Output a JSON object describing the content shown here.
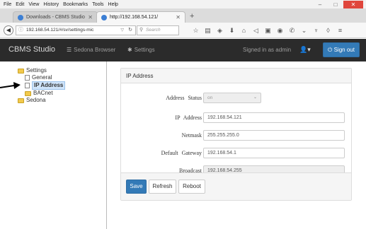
{
  "browser": {
    "menu": [
      "File",
      "Edit",
      "View",
      "History",
      "Bookmarks",
      "Tools",
      "Help"
    ],
    "window_controls": {
      "minimize": "–",
      "maximize": "□",
      "close": "✕"
    },
    "tabs": [
      {
        "label": "Downloads - CBMS Studio",
        "close": "✕"
      },
      {
        "label": "http://192.168.54.121/",
        "close": "✕"
      }
    ],
    "new_tab": "+",
    "url": "192.168.54.121/#/sv/settings-mic",
    "search_placeholder": "Search"
  },
  "app": {
    "brand": "CBMS Studio",
    "nav": {
      "sedona_browser": "Sedona Browser",
      "settings": "Settings"
    },
    "signed_in": "Signed in as admin",
    "sign_out": "Sign out"
  },
  "tree": {
    "settings": "Settings",
    "general": "General",
    "ip_address": "IP Address",
    "bacnet": "BACnet",
    "sedona": "Sedona"
  },
  "panel": {
    "heading": "IP Address",
    "fields": {
      "address_status": {
        "label": "Address Status",
        "value": "on"
      },
      "ip_address": {
        "label": "IP Address",
        "value": "192.168.54.121"
      },
      "netmask": {
        "label": "Netmask",
        "value": "255.255.255.0"
      },
      "default_gateway": {
        "label": "Default Gateway",
        "value": "192.168.54.1"
      },
      "broadcast": {
        "label": "Broadcast",
        "value": "192.168.54.255"
      }
    },
    "buttons": {
      "save": "Save",
      "refresh": "Refresh",
      "reboot": "Reboot"
    }
  },
  "colors": {
    "primary": "#337ab7",
    "navbar": "#2b2b2b",
    "close": "#e0463c"
  }
}
